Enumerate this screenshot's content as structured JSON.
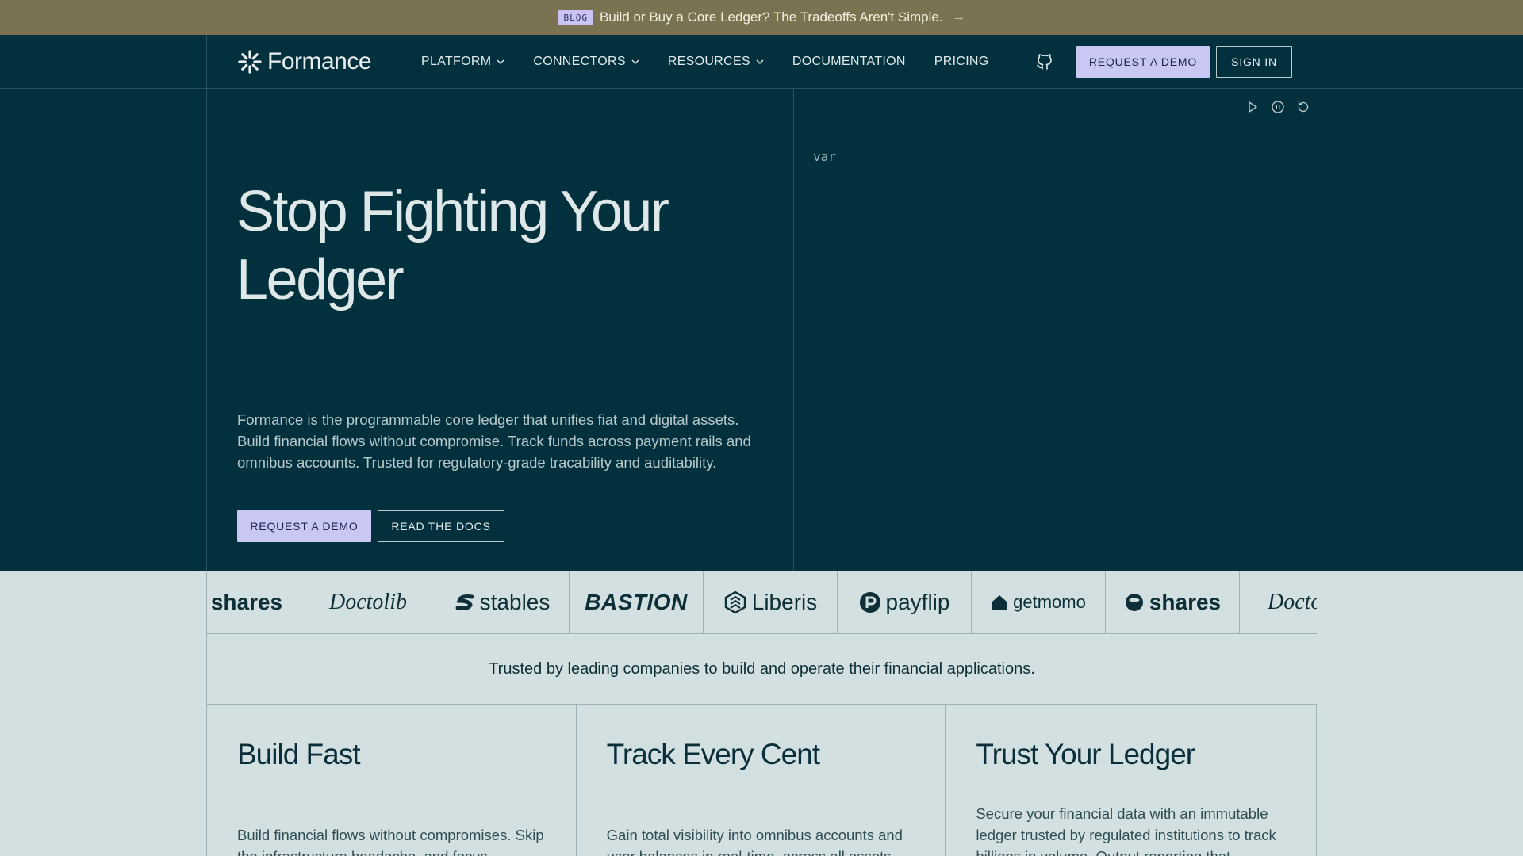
{
  "announcement": {
    "badge": "BLOG",
    "text": "Build or Buy a Core Ledger? The Tradeoffs Aren't Simple.",
    "arrow": "→"
  },
  "nav": {
    "brand": "Formance",
    "menu": [
      {
        "label": "PLATFORM",
        "dropdown": true
      },
      {
        "label": "CONNECTORS",
        "dropdown": true
      },
      {
        "label": "RESOURCES",
        "dropdown": true
      },
      {
        "label": "DOCUMENTATION",
        "dropdown": false
      },
      {
        "label": "PRICING",
        "dropdown": false
      }
    ],
    "demo_label": "REQUEST A DEMO",
    "signin_label": "SIGN IN"
  },
  "hero": {
    "title": "Stop Fighting Your Ledger",
    "lead": "Formance is the programmable core ledger that unifies fiat and digital assets. Build financial flows without compromise. Track funds across payment rails and omnibus accounts. Trusted for regulatory-grade tracability and auditability.",
    "cta_primary": "REQUEST A DEMO",
    "cta_secondary": "READ THE DOCS",
    "code_text": "var"
  },
  "logos": [
    "shares",
    "Doctolib",
    "stables",
    "BASTION",
    "Liberis",
    "payflip",
    "getmomo",
    "shares",
    "Doctolib"
  ],
  "trusted_text": "Trusted by leading companies to build and operate their financial applications.",
  "features": [
    {
      "title": "Build Fast",
      "text": "Build financial flows without compromises. Skip the infrastructure headache, and focus"
    },
    {
      "title": "Track Every Cent",
      "text": "Gain total visibility into omnibus accounts and user balances in real-time, across all assets"
    },
    {
      "title": "Trust Your Ledger",
      "text": "Secure your financial data with an immutable ledger trusted by regulated institutions to track billions in volume. Output reporting that"
    }
  ],
  "colors": {
    "announce_bg": "#7a7250",
    "dark_bg": "#02313d",
    "light_bg": "#d3e0e2",
    "accent_button": "#c9c8f5"
  }
}
